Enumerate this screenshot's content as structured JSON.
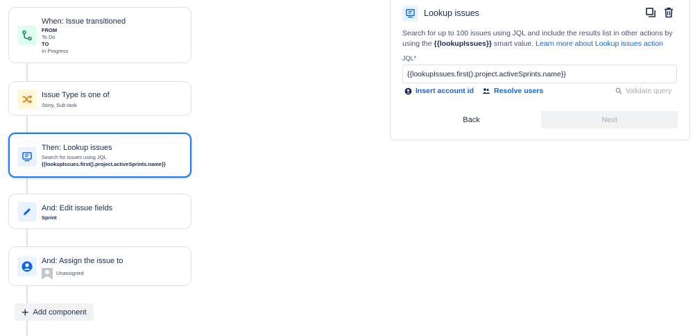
{
  "flow": {
    "trigger": {
      "title": "When: Issue transitioned",
      "from_label": "FROM",
      "from_value": "To Do",
      "to_label": "TO",
      "to_value": "In Progress",
      "icon": "branch-icon",
      "icon_color": "#1f845a"
    },
    "condition": {
      "title": "Issue Type is one of",
      "subtitle": "Story, Sub-task",
      "icon": "shuffle-icon",
      "icon_color": "#e2740f"
    },
    "lookup_action": {
      "title": "Then: Lookup issues",
      "subtitle": "Search for issues using JQL",
      "query": "{{lookupIssues.first().project.activeSprints.name}}",
      "icon": "monitor-icon"
    },
    "edit_action": {
      "title": "And: Edit issue fields",
      "subtitle": "Sprint",
      "icon": "pencil-icon"
    },
    "assign_action": {
      "title": "And: Assign the issue to",
      "subtitle": "Unassigned",
      "icon": "person-circle-icon"
    },
    "add_component_label": "Add component"
  },
  "panel": {
    "title": "Lookup issues",
    "icon": "monitor-icon",
    "desc_part1": "Search for up to 100 issues using JQL and include the results list in other actions by using the ",
    "smart_value": "{{lookupIssues}}",
    "desc_part2": " smart value. ",
    "learn_more": "Learn more about Lookup issues action",
    "jql_label": "JQL",
    "required_mark": "*",
    "jql_value": "{{lookupIssues.first().project.activeSprints.name}}",
    "insert_account": "Insert account id",
    "resolve_users": "Resolve users",
    "validate_query": "Validate query",
    "back_label": "Back",
    "next_label": "Next"
  },
  "colors": {
    "accent": "#1d7afc",
    "link": "#0c66e4",
    "icon_blue": "#0c66e4"
  }
}
